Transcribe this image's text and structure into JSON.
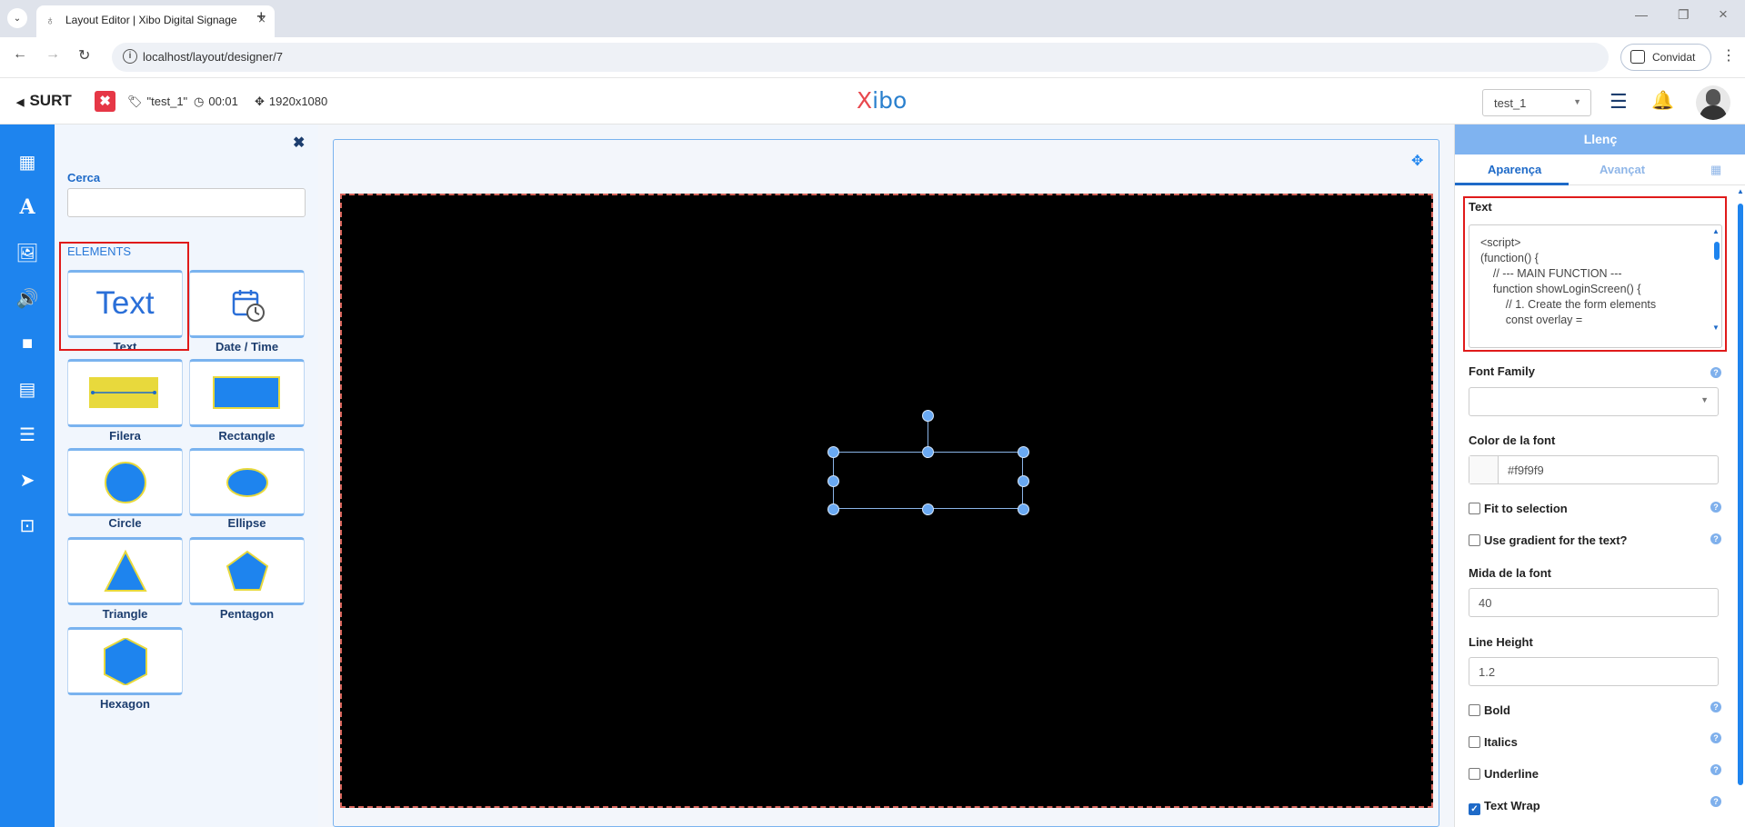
{
  "browser": {
    "tab_title": "Layout Editor | Xibo Digital Signage",
    "url": "localhost/layout/designer/7",
    "guest_label": "Convidat"
  },
  "header": {
    "back_label": "SURT",
    "layout_name": "\"test_1\"",
    "duration": "00:01",
    "resolution": "1920x1080",
    "logo_x": "X",
    "logo_rest": "ibo",
    "layout_select_value": "test_1"
  },
  "sidebar_icons": [
    "widgets-icon",
    "text-icon",
    "image-icon",
    "audio-icon",
    "video-icon",
    "archive-icon",
    "list-icon",
    "send-icon",
    "layout-icon"
  ],
  "toolbox": {
    "search_label": "Cerca",
    "search_placeholder": "",
    "elements_heading": "ELEMENTS",
    "elements": [
      {
        "label": "Text",
        "icon": "text-icon"
      },
      {
        "label": "Date / Time",
        "icon": "calendar-clock-icon"
      },
      {
        "label": "Filera",
        "icon": "line-icon"
      },
      {
        "label": "Rectangle",
        "icon": "rectangle-icon"
      },
      {
        "label": "Circle",
        "icon": "circle-icon"
      },
      {
        "label": "Ellipse",
        "icon": "ellipse-icon"
      },
      {
        "label": "Triangle",
        "icon": "triangle-icon"
      },
      {
        "label": "Pentagon",
        "icon": "pentagon-icon"
      },
      {
        "label": "Hexagon",
        "icon": "hexagon-icon"
      }
    ],
    "text_preview": "Text"
  },
  "properties": {
    "title": "Llenç",
    "tabs": [
      "Aparença",
      "Avançat"
    ],
    "text_label": "Text",
    "text_code": [
      "<script>",
      "(function() {",
      "    // --- MAIN FUNCTION ---",
      "    function showLoginScreen() {",
      "        // 1. Create the form elements",
      "        const overlay ="
    ],
    "font_family_label": "Font Family",
    "font_family_value": "",
    "font_color_label": "Color de la font",
    "font_color_value": "#f9f9f9",
    "fit_to_selection": "Fit to selection",
    "use_gradient": "Use gradient for the text?",
    "font_size_label": "Mida de la font",
    "font_size_value": "40",
    "line_height_label": "Line Height",
    "line_height_value": "1.2",
    "bold": "Bold",
    "italics": "Italics",
    "underline": "Underline",
    "text_wrap": "Text Wrap"
  },
  "colors": {
    "sidebar": "#1e84ee",
    "accent": "#1e6ac8",
    "highlight": "#e01a1a",
    "canvas_bg": "#000000"
  }
}
